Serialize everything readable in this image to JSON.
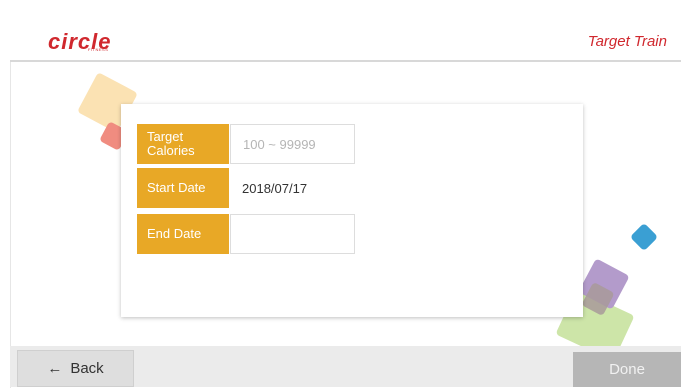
{
  "header": {
    "logo_text": "circle",
    "logo_subtext": "FITNESS",
    "title": "Target Train"
  },
  "form": {
    "target_calories": {
      "label": "Target Calories",
      "placeholder": "100 ~ 99999",
      "value": ""
    },
    "start_date": {
      "label": "Start Date",
      "value": "2018/07/17"
    },
    "end_date": {
      "label": "End Date",
      "value": ""
    }
  },
  "footer": {
    "back_label": "Back",
    "back_icon": "arrow-left-icon",
    "done_label": "Done"
  },
  "colors": {
    "brand": "#d0282e",
    "label_bg": "#e8a826",
    "done_disabled": "#b6b6b6"
  }
}
